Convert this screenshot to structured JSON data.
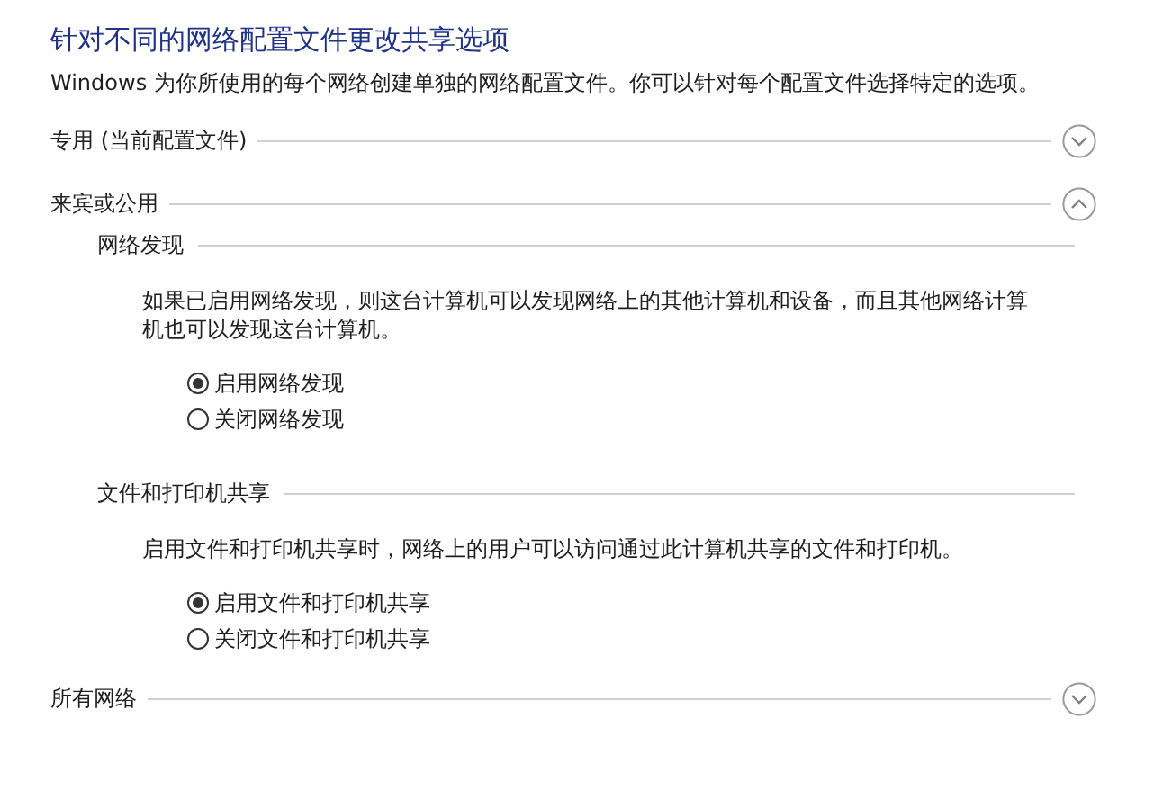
{
  "title": "针对不同的网络配置文件更改共享选项",
  "description": "Windows 为你所使用的每个网络创建单独的网络配置文件。你可以针对每个配置文件选择特定的选项。",
  "profiles": [
    {
      "name": "专用 (当前配置文件)",
      "expanded": false
    },
    {
      "name": "来宾或公用",
      "expanded": true,
      "sections": [
        {
          "title": "网络发现",
          "description": "如果已启用网络发现，则这台计算机可以发现网络上的其他计算机和设备，而且其他网络计算机也可以发现这台计算机。",
          "options": [
            {
              "label": "启用网络发现",
              "selected": true
            },
            {
              "label": "关闭网络发现",
              "selected": false
            }
          ]
        },
        {
          "title": "文件和打印机共享",
          "description": "启用文件和打印机共享时，网络上的用户可以访问通过此计算机共享的文件和打印机。",
          "options": [
            {
              "label": "启用文件和打印机共享",
              "selected": true
            },
            {
              "label": "关闭文件和打印机共享",
              "selected": false
            }
          ]
        }
      ]
    },
    {
      "name": "所有网络",
      "expanded": false
    }
  ]
}
